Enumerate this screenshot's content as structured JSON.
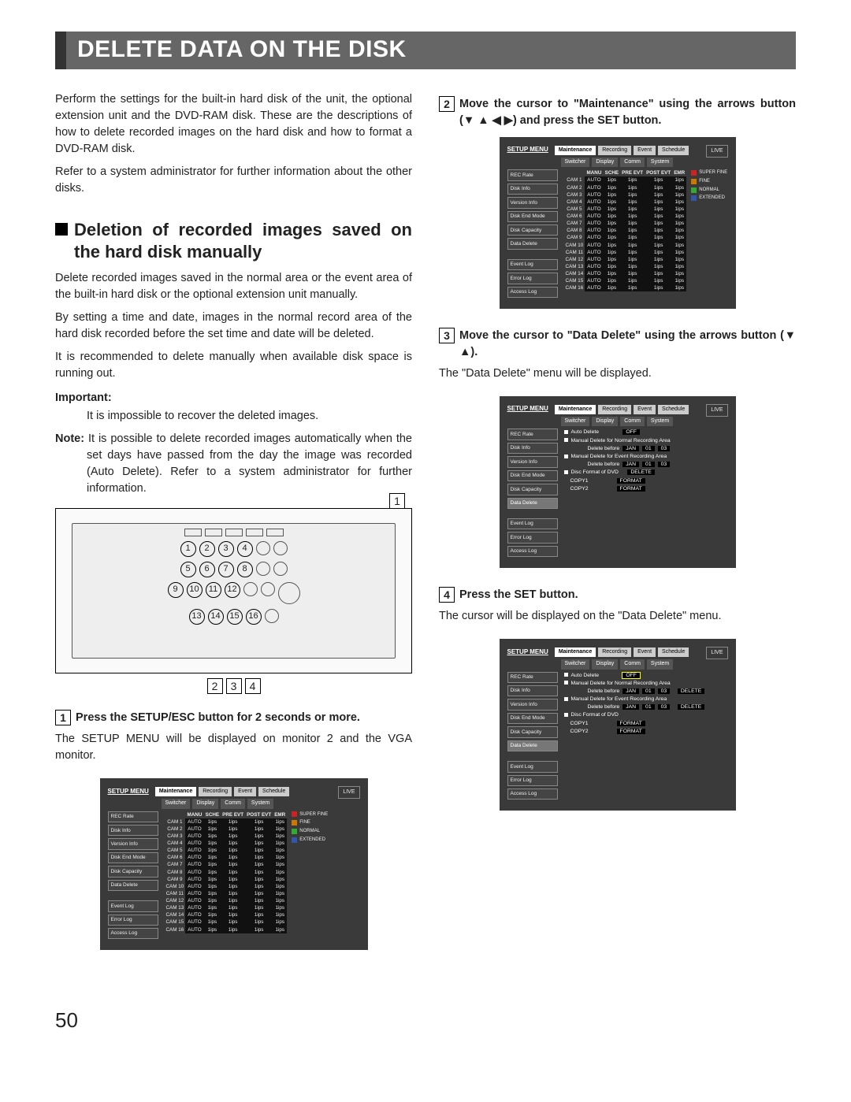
{
  "page_number": "50",
  "title": "DELETE DATA ON THE DISK",
  "intro_p1": "Perform the settings for the built-in hard disk of the unit, the optional extension unit and the DVD-RAM disk. These are the descriptions of how to delete recorded images on the hard disk and how to format a DVD-RAM disk.",
  "intro_p2": "Refer to a system administrator for further information about the other disks.",
  "section_heading": "Deletion of recorded images saved on the hard disk manually",
  "sec_p1": "Delete recorded images saved in the normal area or the event area of the built-in hard disk or the optional extension unit manually.",
  "sec_p2": "By setting a time and date, images in the normal record area of the hard disk recorded before the set time and date will be deleted.",
  "sec_p3": "It is recommended to delete manually when available disk space is running out.",
  "important_label": "Important:",
  "important_text": "It is impossible to recover the deleted images.",
  "note_label": "Note:",
  "note_text": " It is possible to delete recorded images automatically when the set days have passed from the day the image was recorded (Auto Delete). Refer to a system administrator for further information.",
  "step1_num": "1",
  "step1_text": "Press the SETUP/ESC button for 2 seconds or more.",
  "step1_sub": "The SETUP MENU will be displayed on monitor 2 and the VGA monitor.",
  "step2_num": "2",
  "step2_text_a": "Move the cursor to \"Maintenance\" using the arrows button (",
  "step2_text_arrows": "▼ ▲ ◀ ▶",
  "step2_text_b": ") and press the SET button.",
  "step3_num": "3",
  "step3_text_a": "Move the cursor to \"Data Delete\" using the arrows button (",
  "step3_text_arrows": "▼ ▲",
  "step3_text_b": ").",
  "step3_sub": "The \"Data Delete\" menu will be displayed.",
  "step4_num": "4",
  "step4_text": "Press the SET button.",
  "step4_sub": "The cursor will be displayed on the \"Data Delete\" menu.",
  "bottom_tags": [
    "2",
    "3",
    "4"
  ],
  "menu": {
    "setup_label": "SETUP MENU",
    "live_label": "LIVE",
    "tabs1": [
      "Maintenance",
      "Recording",
      "Event",
      "Schedule"
    ],
    "tabs2": [
      "Switcher",
      "Display",
      "Comm",
      "System"
    ],
    "sidebar": [
      "REC Rate",
      "Disk Info",
      "Version Info",
      "Disk End Mode",
      "Disk Capacity",
      "Data Delete",
      "",
      "Event Log",
      "Error Log",
      "Access Log"
    ],
    "cam_cols": [
      "MANU",
      "SCHE",
      "PRE EVT",
      "POST EVT",
      "EMR"
    ],
    "cam_rows": [
      "CAM 1",
      "CAM 2",
      "CAM 3",
      "CAM 4",
      "CAM 5",
      "CAM 6",
      "CAM 7",
      "CAM 8",
      "CAM 9",
      "CAM 10",
      "CAM 11",
      "CAM 12",
      "CAM 13",
      "CAM 14",
      "CAM 15",
      "CAM 16"
    ],
    "cam_cell": "1ips",
    "cam_first": "AUTO",
    "legend": [
      "SUPER FINE",
      "FINE",
      "NORMAL",
      "EXTENDED"
    ]
  },
  "dd_menu": {
    "auto_delete": "Auto Delete",
    "off": "OFF",
    "mdn": "Manual Delete for Normal Recording Area",
    "del_before": "Delete before",
    "month": "JAN",
    "day": "01",
    "year": "03",
    "mde": "Manual Delete for Event Recording Area",
    "disc_fmt": "Disc Format of DVD",
    "copy1": "COPY1",
    "copy2": "COPY2",
    "delete_btn": "DELETE",
    "format_btn": "FORMAT"
  }
}
